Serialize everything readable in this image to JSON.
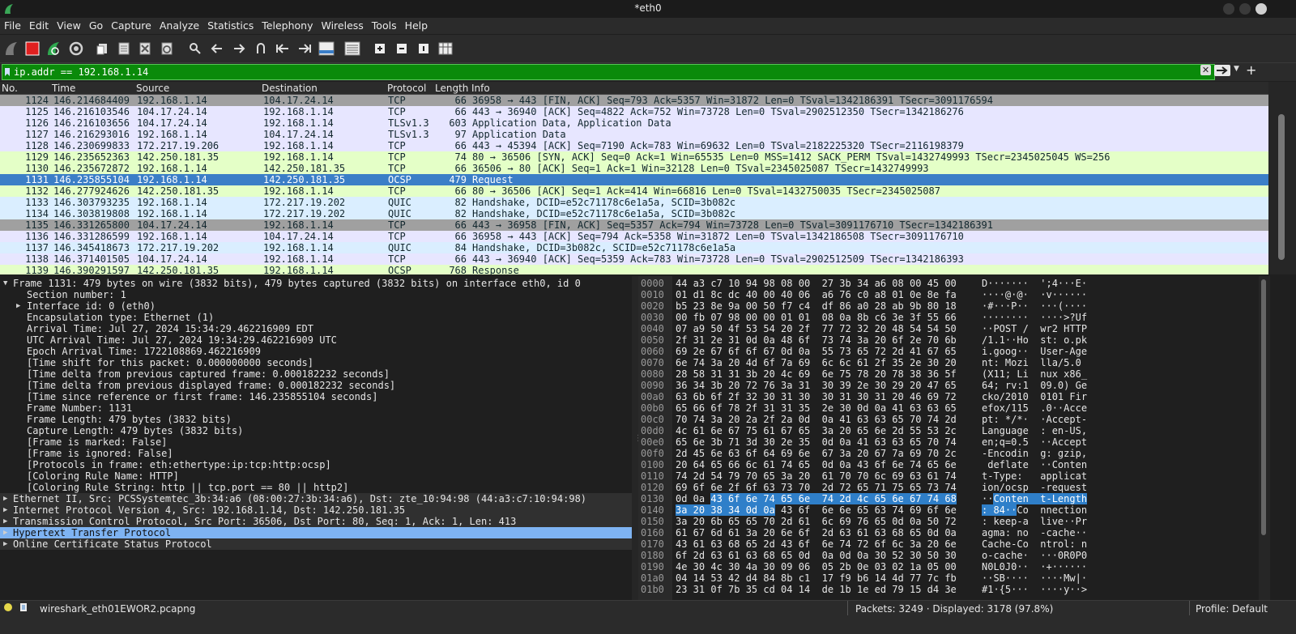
{
  "window": {
    "title": "*eth0"
  },
  "menu": [
    {
      "label": "File",
      "u": "F",
      "rest": "ile"
    },
    {
      "label": "Edit",
      "u": "E",
      "rest": "dit"
    },
    {
      "label": "View",
      "u": "V",
      "rest": "iew"
    },
    {
      "label": "Go",
      "u": "G",
      "rest": "o"
    },
    {
      "label": "Capture",
      "u": "C",
      "rest": "apture"
    },
    {
      "label": "Analyze",
      "u": "A",
      "rest": "nalyze"
    },
    {
      "label": "Statistics",
      "u": "S",
      "rest": "tatistics"
    },
    {
      "label": "Telephony",
      "u": "y",
      "rest": "Telephon"
    },
    {
      "label": "Wireless",
      "u": "W",
      "rest": "ireless"
    },
    {
      "label": "Tools",
      "u": "T",
      "rest": "ools"
    },
    {
      "label": "Help",
      "u": "H",
      "rest": "elp"
    }
  ],
  "toolbar_icons": [
    "shark-fin-start-icon",
    "stop-capture-icon",
    "restart-capture-icon",
    "capture-options-icon",
    "open-file-icon",
    "save-file-icon",
    "close-file-icon",
    "reload-file-icon",
    "find-packet-icon",
    "go-back-icon",
    "go-forward-icon",
    "go-to-packet-icon",
    "go-first-icon",
    "go-last-icon",
    "auto-scroll-icon",
    "colorize-icon",
    "zoom-in-icon",
    "zoom-out-icon",
    "normal-size-icon",
    "resize-columns-icon"
  ],
  "filter": {
    "value": "ip.addr == 192.168.1.14"
  },
  "columns": [
    "No.",
    "Time",
    "Source",
    "Destination",
    "Protocol",
    "Length",
    "Info"
  ],
  "colors": {
    "tcp": "#e7e6ff",
    "fin": "#a0a0a0",
    "udp": "#daeeff",
    "http": "#e4ffc7",
    "selected": "#3b7ec7"
  },
  "packets": [
    {
      "no": "1124",
      "time": "146.214684409",
      "src": "192.168.1.14",
      "dst": "104.17.24.14",
      "proto": "TCP",
      "len": "66",
      "info": "36958 → 443 [FIN, ACK] Seq=793 Ack=5357 Win=31872 Len=0 TSval=1342186391 TSecr=3091176594",
      "color": "fin"
    },
    {
      "no": "1125",
      "time": "146.216103546",
      "src": "104.17.24.14",
      "dst": "192.168.1.14",
      "proto": "TCP",
      "len": "66",
      "info": "443 → 36940 [ACK] Seq=4822 Ack=752 Win=73728 Len=0 TSval=2902512350 TSecr=1342186276",
      "color": "tcp"
    },
    {
      "no": "1126",
      "time": "146.216103656",
      "src": "104.17.24.14",
      "dst": "192.168.1.14",
      "proto": "TLSv1.3",
      "len": "603",
      "info": "Application Data, Application Data",
      "color": "tcp"
    },
    {
      "no": "1127",
      "time": "146.216293016",
      "src": "192.168.1.14",
      "dst": "104.17.24.14",
      "proto": "TLSv1.3",
      "len": "97",
      "info": "Application Data",
      "color": "tcp"
    },
    {
      "no": "1128",
      "time": "146.230699833",
      "src": "172.217.19.206",
      "dst": "192.168.1.14",
      "proto": "TCP",
      "len": "66",
      "info": "443 → 45394 [ACK] Seq=7190 Ack=783 Win=69632 Len=0 TSval=2182225320 TSecr=2116198379",
      "color": "tcp"
    },
    {
      "no": "1129",
      "time": "146.235652363",
      "src": "142.250.181.35",
      "dst": "192.168.1.14",
      "proto": "TCP",
      "len": "74",
      "info": "80 → 36506 [SYN, ACK] Seq=0 Ack=1 Win=65535 Len=0 MSS=1412 SACK_PERM TSval=1432749993 TSecr=2345025045 WS=256",
      "color": "http"
    },
    {
      "no": "1130",
      "time": "146.235672872",
      "src": "192.168.1.14",
      "dst": "142.250.181.35",
      "proto": "TCP",
      "len": "66",
      "info": "36506 → 80 [ACK] Seq=1 Ack=1 Win=32128 Len=0 TSval=2345025087 TSecr=1432749993",
      "color": "http"
    },
    {
      "no": "1131",
      "time": "146.235855104",
      "src": "192.168.1.14",
      "dst": "142.250.181.35",
      "proto": "OCSP",
      "len": "479",
      "info": "Request",
      "color": "selected"
    },
    {
      "no": "1132",
      "time": "146.277924626",
      "src": "142.250.181.35",
      "dst": "192.168.1.14",
      "proto": "TCP",
      "len": "66",
      "info": "80 → 36506 [ACK] Seq=1 Ack=414 Win=66816 Len=0 TSval=1432750035 TSecr=2345025087",
      "color": "http"
    },
    {
      "no": "1133",
      "time": "146.303793235",
      "src": "192.168.1.14",
      "dst": "172.217.19.202",
      "proto": "QUIC",
      "len": "82",
      "info": "Handshake, DCID=e52c71178c6e1a5a, SCID=3b082c",
      "color": "udp"
    },
    {
      "no": "1134",
      "time": "146.303819808",
      "src": "192.168.1.14",
      "dst": "172.217.19.202",
      "proto": "QUIC",
      "len": "82",
      "info": "Handshake, DCID=e52c71178c6e1a5a, SCID=3b082c",
      "color": "udp"
    },
    {
      "no": "1135",
      "time": "146.331265800",
      "src": "104.17.24.14",
      "dst": "192.168.1.14",
      "proto": "TCP",
      "len": "66",
      "info": "443 → 36958 [FIN, ACK] Seq=5357 Ack=794 Win=73728 Len=0 TSval=3091176710 TSecr=1342186391",
      "color": "fin"
    },
    {
      "no": "1136",
      "time": "146.331286599",
      "src": "192.168.1.14",
      "dst": "104.17.24.14",
      "proto": "TCP",
      "len": "66",
      "info": "36958 → 443 [ACK] Seq=794 Ack=5358 Win=31872 Len=0 TSval=1342186508 TSecr=3091176710",
      "color": "tcp"
    },
    {
      "no": "1137",
      "time": "146.345418673",
      "src": "172.217.19.202",
      "dst": "192.168.1.14",
      "proto": "QUIC",
      "len": "84",
      "info": "Handshake, DCID=3b082c, SCID=e52c71178c6e1a5a",
      "color": "udp"
    },
    {
      "no": "1138",
      "time": "146.371401505",
      "src": "104.17.24.14",
      "dst": "192.168.1.14",
      "proto": "TCP",
      "len": "66",
      "info": "443 → 36940 [ACK] Seq=5359 Ack=783 Win=73728 Len=0 TSval=2902512509 TSecr=1342186393",
      "color": "tcp"
    },
    {
      "no": "1139",
      "time": "146.390291597",
      "src": "142.250.181.35",
      "dst": "192.168.1.14",
      "proto": "OCSP",
      "len": "768",
      "info": "Response",
      "color": "http"
    }
  ],
  "details": [
    {
      "text": "Frame 1131: 479 bytes on wire (3832 bits), 479 bytes captured (3832 bits) on interface eth0, id 0",
      "indent": 0,
      "arrow": "down"
    },
    {
      "text": "Section number: 1",
      "indent": 1,
      "arrow": ""
    },
    {
      "text": "Interface id: 0 (eth0)",
      "indent": 1,
      "arrow": "right"
    },
    {
      "text": "Encapsulation type: Ethernet (1)",
      "indent": 1,
      "arrow": ""
    },
    {
      "text": "Arrival Time: Jul 27, 2024 15:34:29.462216909 EDT",
      "indent": 1,
      "arrow": ""
    },
    {
      "text": "UTC Arrival Time: Jul 27, 2024 19:34:29.462216909 UTC",
      "indent": 1,
      "arrow": ""
    },
    {
      "text": "Epoch Arrival Time: 1722108869.462216909",
      "indent": 1,
      "arrow": ""
    },
    {
      "text": "[Time shift for this packet: 0.000000000 seconds]",
      "indent": 1,
      "arrow": ""
    },
    {
      "text": "[Time delta from previous captured frame: 0.000182232 seconds]",
      "indent": 1,
      "arrow": ""
    },
    {
      "text": "[Time delta from previous displayed frame: 0.000182232 seconds]",
      "indent": 1,
      "arrow": ""
    },
    {
      "text": "[Time since reference or first frame: 146.235855104 seconds]",
      "indent": 1,
      "arrow": ""
    },
    {
      "text": "Frame Number: 1131",
      "indent": 1,
      "arrow": ""
    },
    {
      "text": "Frame Length: 479 bytes (3832 bits)",
      "indent": 1,
      "arrow": ""
    },
    {
      "text": "Capture Length: 479 bytes (3832 bits)",
      "indent": 1,
      "arrow": ""
    },
    {
      "text": "[Frame is marked: False]",
      "indent": 1,
      "arrow": ""
    },
    {
      "text": "[Frame is ignored: False]",
      "indent": 1,
      "arrow": ""
    },
    {
      "text": "[Protocols in frame: eth:ethertype:ip:tcp:http:ocsp]",
      "indent": 1,
      "arrow": ""
    },
    {
      "text": "[Coloring Rule Name: HTTP]",
      "indent": 1,
      "arrow": ""
    },
    {
      "text": "[Coloring Rule String: http || tcp.port == 80 || http2]",
      "indent": 1,
      "arrow": ""
    },
    {
      "text": "Ethernet II, Src: PCSSystemtec_3b:34:a6 (08:00:27:3b:34:a6), Dst: zte_10:94:98 (44:a3:c7:10:94:98)",
      "indent": 0,
      "arrow": "right",
      "shade": true
    },
    {
      "text": "Internet Protocol Version 4, Src: 192.168.1.14, Dst: 142.250.181.35",
      "indent": 0,
      "arrow": "right",
      "shade": true
    },
    {
      "text": "Transmission Control Protocol, Src Port: 36506, Dst Port: 80, Seq: 1, Ack: 1, Len: 413",
      "indent": 0,
      "arrow": "right",
      "shade": true
    },
    {
      "text": "Hypertext Transfer Protocol",
      "indent": 0,
      "arrow": "right",
      "sel": true
    },
    {
      "text": "Online Certificate Status Protocol",
      "indent": 0,
      "arrow": "right",
      "shade": true
    }
  ],
  "bytes": [
    {
      "off": "0000",
      "hex": "44 a3 c7 10 94 98 08 00  27 3b 34 a6 08 00 45 00",
      "asc": "D·······  ';4···E·"
    },
    {
      "off": "0010",
      "hex": "01 d1 8c dc 40 00 40 06  a6 76 c0 a8 01 0e 8e fa",
      "asc": "····@·@·  ·v······"
    },
    {
      "off": "0020",
      "hex": "b5 23 8e 9a 00 50 f7 c4  df 86 a0 28 ab 9b 80 18",
      "asc": "·#···P··  ···(····"
    },
    {
      "off": "0030",
      "hex": "00 fb 07 98 00 00 01 01  08 0a 8b c6 3e 3f 55 66",
      "asc": "········  ····>?Uf"
    },
    {
      "off": "0040",
      "hex": "07 a9 50 4f 53 54 20 2f  77 72 32 20 48 54 54 50",
      "asc": "··POST /  wr2 HTTP"
    },
    {
      "off": "0050",
      "hex": "2f 31 2e 31 0d 0a 48 6f  73 74 3a 20 6f 2e 70 6b",
      "asc": "/1.1··Ho  st: o.pk"
    },
    {
      "off": "0060",
      "hex": "69 2e 67 6f 6f 67 0d 0a  55 73 65 72 2d 41 67 65",
      "asc": "i.goog··  User-Age"
    },
    {
      "off": "0070",
      "hex": "6e 74 3a 20 4d 6f 7a 69  6c 6c 61 2f 35 2e 30 20",
      "asc": "nt: Mozi  lla/5.0 "
    },
    {
      "off": "0080",
      "hex": "28 58 31 31 3b 20 4c 69  6e 75 78 20 78 38 36 5f",
      "asc": "(X11; Li  nux x86_"
    },
    {
      "off": "0090",
      "hex": "36 34 3b 20 72 76 3a 31  30 39 2e 30 29 20 47 65",
      "asc": "64; rv:1  09.0) Ge"
    },
    {
      "off": "00a0",
      "hex": "63 6b 6f 2f 32 30 31 30  30 31 30 31 20 46 69 72",
      "asc": "cko/2010  0101 Fir"
    },
    {
      "off": "00b0",
      "hex": "65 66 6f 78 2f 31 31 35  2e 30 0d 0a 41 63 63 65",
      "asc": "efox/115  .0··Acce"
    },
    {
      "off": "00c0",
      "hex": "70 74 3a 20 2a 2f 2a 0d  0a 41 63 63 65 70 74 2d",
      "asc": "pt: */*·  ·Accept-"
    },
    {
      "off": "00d0",
      "hex": "4c 61 6e 67 75 61 67 65  3a 20 65 6e 2d 55 53 2c",
      "asc": "Language  : en-US,"
    },
    {
      "off": "00e0",
      "hex": "65 6e 3b 71 3d 30 2e 35  0d 0a 41 63 63 65 70 74",
      "asc": "en;q=0.5  ··Accept"
    },
    {
      "off": "00f0",
      "hex": "2d 45 6e 63 6f 64 69 6e  67 3a 20 67 7a 69 70 2c",
      "asc": "-Encodin  g: gzip,"
    },
    {
      "off": "0100",
      "hex": "20 64 65 66 6c 61 74 65  0d 0a 43 6f 6e 74 65 6e",
      "asc": " deflate  ··Conten"
    },
    {
      "off": "0110",
      "hex": "74 2d 54 79 70 65 3a 20  61 70 70 6c 69 63 61 74",
      "asc": "t-Type:   applicat"
    },
    {
      "off": "0120",
      "hex": "69 6f 6e 2f 6f 63 73 70  2d 72 65 71 75 65 73 74",
      "asc": "ion/ocsp  -request"
    },
    {
      "off": "0130",
      "hex": "0d 0a 43 6f 6e 74 65 6e  74 2d 4c 65 6e 67 74 68",
      "asc": "··Conten  t-Length",
      "hlhex": [
        6,
        49
      ],
      "hlasc": [
        2,
        18
      ]
    },
    {
      "off": "0140",
      "hex": "3a 20 38 34 0d 0a 43 6f  6e 6e 65 63 74 69 6f 6e",
      "asc": ": 84··Co  nnection",
      "hlhex": [
        0,
        17
      ],
      "hlasc": [
        0,
        6
      ]
    },
    {
      "off": "0150",
      "hex": "3a 20 6b 65 65 70 2d 61  6c 69 76 65 0d 0a 50 72",
      "asc": ": keep-a  live··Pr"
    },
    {
      "off": "0160",
      "hex": "61 67 6d 61 3a 20 6e 6f  2d 63 61 63 68 65 0d 0a",
      "asc": "agma: no  -cache··"
    },
    {
      "off": "0170",
      "hex": "43 61 63 68 65 2d 43 6f  6e 74 72 6f 6c 3a 20 6e",
      "asc": "Cache-Co  ntrol: n"
    },
    {
      "off": "0180",
      "hex": "6f 2d 63 61 63 68 65 0d  0a 0d 0a 30 52 30 50 30",
      "asc": "o-cache·  ···0R0P0"
    },
    {
      "off": "0190",
      "hex": "4e 30 4c 30 4a 30 09 06  05 2b 0e 03 02 1a 05 00",
      "asc": "N0L0J0··  ·+······"
    },
    {
      "off": "01a0",
      "hex": "04 14 53 42 d4 84 8b c1  17 f9 b6 14 4d 77 7c fb",
      "asc": "··SB····  ····Mw|·"
    },
    {
      "off": "01b0",
      "hex": "23 31 0f 7b 35 cd 04 14  de 1b 1e ed 79 15 d4 3e",
      "asc": "#1·{5···  ····y··>"
    }
  ],
  "status": {
    "file": "wireshark_eth01EWOR2.pcapng",
    "packets": "Packets: 3249 · Displayed: 3178 (97.8%)",
    "profile": "Profile: Default"
  }
}
